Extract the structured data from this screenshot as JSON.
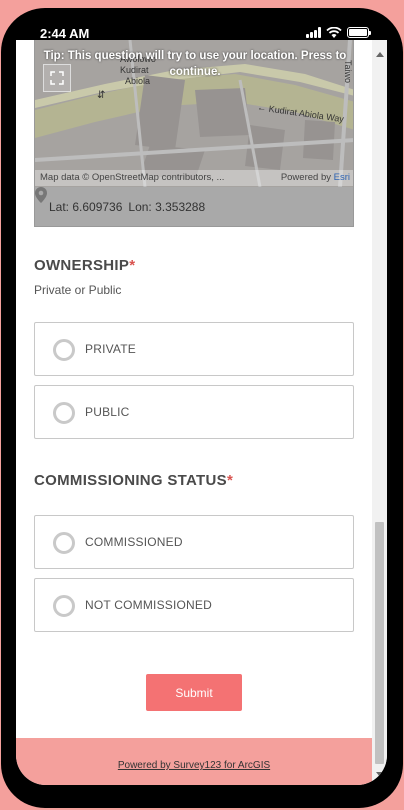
{
  "status_bar": {
    "time": "2:44 AM",
    "icons": [
      "signal-icon",
      "wifi-icon",
      "battery-icon"
    ]
  },
  "map": {
    "tip": "Tip: This question will try to use your location. Press to continue.",
    "street_labels": [
      "Awolowo",
      "Kudirat",
      "Abiola",
      "← Kudirat Abiola Way",
      "Taiwo"
    ],
    "attribution": "Map data © OpenStreetMap contributors, ...",
    "powered_by": "Powered by",
    "esri": "Esri",
    "latitude": "Lat: 6.609736",
    "longitude": "Lon: 3.353288"
  },
  "questions": [
    {
      "title": "OWNERSHIP",
      "required_mark": "*",
      "hint": "Private or Public",
      "options": [
        "PRIVATE",
        "PUBLIC"
      ]
    },
    {
      "title": "COMMISSIONING STATUS",
      "required_mark": "*",
      "options": [
        "COMMISSIONED",
        "NOT COMMISSIONED"
      ]
    }
  ],
  "submit_label": "Submit",
  "footer_link": "Powered by Survey123 for ArcGIS",
  "colors": {
    "background": "#f4a09c",
    "submit": "#f47273",
    "required": "#d9534f",
    "footer": "#f4a09c"
  }
}
